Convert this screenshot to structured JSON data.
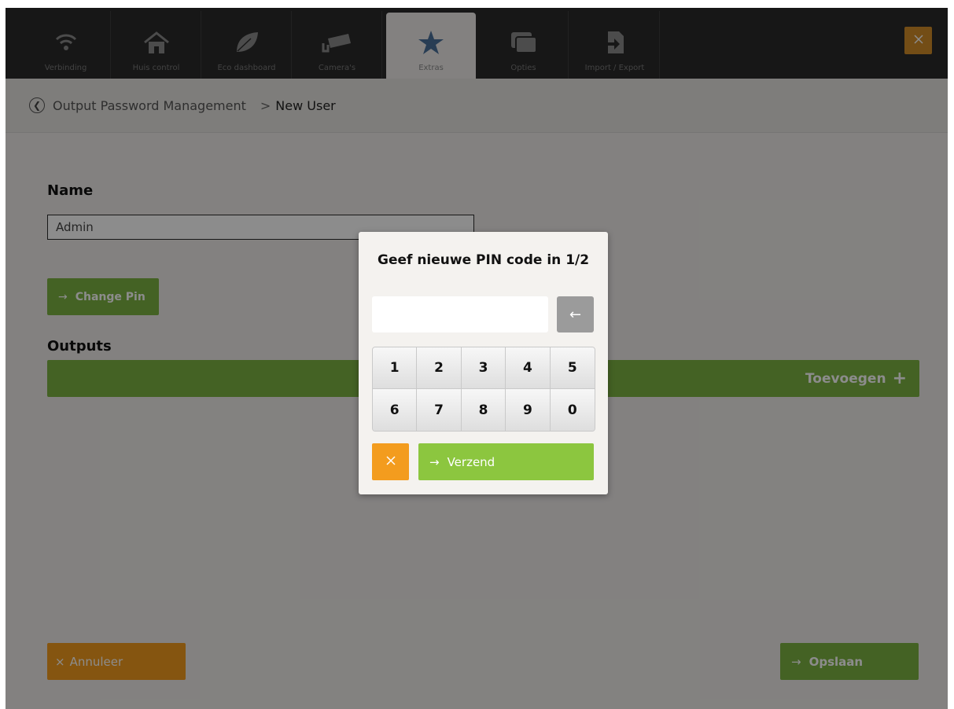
{
  "tabs": [
    {
      "label": "Verbinding",
      "icon": "wifi-icon"
    },
    {
      "label": "Huis control",
      "icon": "home-icon"
    },
    {
      "label": "Eco dashboard",
      "icon": "leaf-icon"
    },
    {
      "label": "Camera's",
      "icon": "camera-icon"
    },
    {
      "label": "Extras",
      "icon": "star-icon",
      "active": true
    },
    {
      "label": "Opties",
      "icon": "windows-icon"
    },
    {
      "label": "Import / Export",
      "icon": "import-export-icon"
    }
  ],
  "breadcrumb": {
    "parent": "Output Password Management",
    "separator": ">",
    "current": "New User"
  },
  "form": {
    "name_label": "Name",
    "name_value": "Admin",
    "change_pin_label": "Change Pin",
    "outputs_label": "Outputs",
    "add_label": "Toevoegen",
    "cancel_label": "Annuleer",
    "save_label": "Opslaan"
  },
  "modal": {
    "title": "Geef nieuwe PIN code in 1/2",
    "pin_value": "",
    "keys": [
      "1",
      "2",
      "3",
      "4",
      "5",
      "6",
      "7",
      "8",
      "9",
      "0"
    ],
    "send_label": "Verzend"
  },
  "colors": {
    "green": "#7cb342",
    "orange": "#f39c1e",
    "dark": "#2b2b2b"
  }
}
